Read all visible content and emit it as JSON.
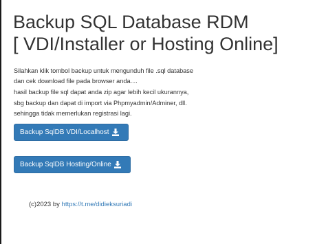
{
  "title": {
    "line1": "Backup SQL Database RDM",
    "line2": "[ VDI/Installer or Hosting Online]"
  },
  "description": {
    "lines": [
      "Silahkan klik tombol backup untuk mengunduh file .sql database",
      "dan cek download file pada browser anda....",
      "hasil backup file sql dapat anda zip agar lebih kecil ukurannya,",
      "sbg backup dan dapat di import via Phpmyadmin/Adminer, dll.",
      "sehingga tidak memerlukan registrasi lagi."
    ]
  },
  "buttons": {
    "local_label": "Backup SqlDB VDI/Localhost",
    "hosting_label": "Backup SqlDB Hosting/Online",
    "icon": "download-icon",
    "color": "#337ab7"
  },
  "footer": {
    "prefix": "(c)2023 by ",
    "link_text": "https://t.me/didieksuriadi",
    "link_color": "#337ab7"
  }
}
